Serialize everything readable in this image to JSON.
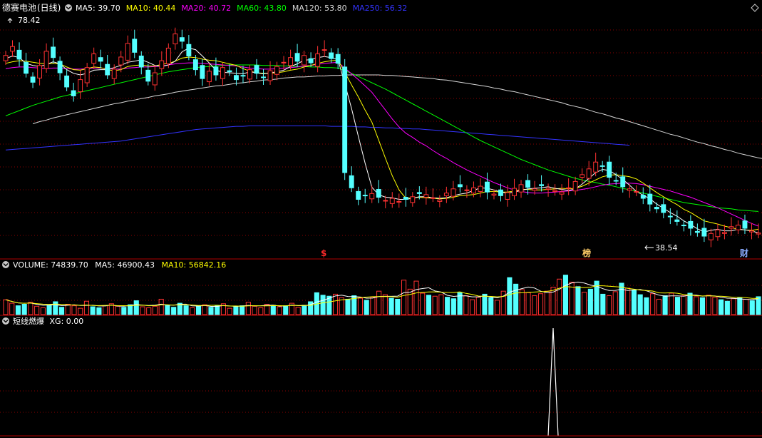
{
  "header": {
    "stock_name": "德赛电池",
    "period": "(日线)",
    "ma": [
      {
        "label": "MA5",
        "value": "39.70",
        "color": "#ffffff"
      },
      {
        "label": "MA10",
        "value": "40.44",
        "color": "#ffff00"
      },
      {
        "label": "MA20",
        "value": "40.72",
        "color": "#ff00ff"
      },
      {
        "label": "MA60",
        "value": "43.80",
        "color": "#00ff00"
      },
      {
        "label": "MA120",
        "value": "53.80",
        "color": "#d8d8d8"
      },
      {
        "label": "MA250",
        "value": "56.32",
        "color": "#3333ff"
      }
    ]
  },
  "price_panel": {
    "max_label": "78.42",
    "min_label": "38.54",
    "markers": [
      {
        "text": "$",
        "color": "#ff2a2a"
      },
      {
        "text": "榜",
        "color": "#ffcc66"
      },
      {
        "text": "财",
        "color": "#88aaff"
      }
    ]
  },
  "volume_header": {
    "title": "VOLUME",
    "value": "74839.70",
    "ma5_label": "MA5",
    "ma5_value": "46900.43",
    "ma10_label": "MA10",
    "ma10_value": "56842.16"
  },
  "indicator_header": {
    "title": "短线燃爆",
    "xg_label": "XG",
    "xg_value": "0.00"
  },
  "colors": {
    "up": "#ff3232",
    "down": "#54ffff",
    "grid": "#8b0000",
    "panel_border": "#b00000"
  },
  "chart_data": {
    "type": "candlestick",
    "series_price": {
      "closes": [
        73.5,
        75.2,
        72.8,
        70.1,
        68.4,
        71.6,
        74.3,
        73.1,
        70.2,
        67.5,
        65.8,
        68.9,
        71.2,
        73.8,
        72.4,
        69.8,
        70.9,
        73.2,
        75.8,
        74.1,
        71.3,
        68.6,
        70.2,
        72.5,
        74.9,
        77.6,
        76.2,
        73.4,
        70.8,
        69.1,
        70.5,
        69.8,
        71.2,
        70.4,
        68.9,
        69.6,
        70.8,
        70.1,
        69.3,
        70.6,
        71.4,
        72.2,
        73.1,
        72.4,
        73.5,
        72.1,
        73.8,
        74.6,
        72.9,
        72.0,
        51.2,
        48.3,
        46.1,
        46.8,
        47.2,
        46.5,
        45.9,
        46.3,
        45.7,
        46.1,
        46.6,
        47.2,
        47.0,
        46.4,
        46.0,
        47.3,
        48.1,
        48.5,
        47.9,
        48.3,
        48.6,
        47.5,
        47.1,
        46.8,
        47.4,
        48.2,
        48.9,
        48.4,
        48.1,
        48.7,
        48.2,
        47.8,
        47.5,
        48.3,
        49.5,
        50.8,
        51.9,
        53.2,
        52.4,
        50.3,
        49.6,
        48.5,
        48.1,
        47.6,
        46.3,
        45.2,
        44.3,
        43.6,
        42.8,
        41.9,
        41.1,
        40.6,
        39.8,
        39.1,
        39.6,
        40.3,
        39.8,
        40.9,
        41.2,
        40.6,
        40.1,
        39.7
      ],
      "ma5": [
        72.9,
        73.4,
        73.1,
        72.0,
        71.6,
        71.4,
        71.8,
        72.3,
        71.9,
        70.8,
        70.1,
        69.8,
        70.1,
        70.7,
        70.8,
        70.8,
        71.2,
        71.6,
        72.2,
        72.4,
        72.7,
        72.2,
        71.6,
        71.4,
        71.7,
        72.4,
        74.2,
        74.9,
        74.6,
        73.4,
        72.1,
        70.7,
        70.3,
        70.2,
        70.1,
        70.0,
        70.4,
        70.2,
        70.0,
        70.2,
        70.4,
        70.7,
        71.4,
        71.9,
        72.6,
        72.7,
        73.1,
        73.3,
        73.1,
        72.7,
        68.1,
        63.4,
        58.1,
        53.0,
        48.4,
        47.0,
        46.5,
        46.4,
        46.1,
        46.1,
        46.3,
        46.6,
        46.6,
        46.4,
        46.3,
        46.4,
        46.8,
        47.1,
        47.3,
        47.8,
        48.3,
        48.2,
        47.9,
        47.5,
        47.3,
        47.5,
        47.8,
        48.1,
        48.2,
        48.3,
        48.5,
        48.2,
        48.0,
        47.8,
        48.1,
        49.0,
        50.1,
        51.2,
        51.8,
        51.6,
        50.8,
        49.9,
        48.8,
        47.6,
        46.9,
        46.2,
        45.2,
        44.4,
        43.6,
        42.9,
        42.0,
        41.3,
        40.5,
        39.9,
        40.2,
        40.4,
        40.1,
        40.1,
        40.4,
        40.3,
        40.1,
        39.7
      ],
      "ma10": [
        72.0,
        72.3,
        72.5,
        72.4,
        72.2,
        72.0,
        71.9,
        72.0,
        71.9,
        71.3,
        70.8,
        70.7,
        71.0,
        71.3,
        71.2,
        70.8,
        70.6,
        70.8,
        71.4,
        71.6,
        71.7,
        71.5,
        71.5,
        71.8,
        72.0,
        72.4,
        73.0,
        73.2,
        73.1,
        72.8,
        72.6,
        72.5,
        72.2,
        71.9,
        71.6,
        71.0,
        70.5,
        70.2,
        70.1,
        70.1,
        70.2,
        70.4,
        70.7,
        70.9,
        71.3,
        71.6,
        72.0,
        72.3,
        72.5,
        72.6,
        70.3,
        67.9,
        65.6,
        63.1,
        60.8,
        57.4,
        53.9,
        50.6,
        47.9,
        46.3,
        46.4,
        46.5,
        46.4,
        46.3,
        46.2,
        46.3,
        46.5,
        46.8,
        46.9,
        47.0,
        47.3,
        47.6,
        47.6,
        47.5,
        47.5,
        47.7,
        48.0,
        48.0,
        47.9,
        47.9,
        48.0,
        48.1,
        48.2,
        48.1,
        48.2,
        48.6,
        49.2,
        49.8,
        50.4,
        50.7,
        50.8,
        50.6,
        50.4,
        50.0,
        49.2,
        48.3,
        47.4,
        46.6,
        45.8,
        45.1,
        44.2,
        43.6,
        42.8,
        42.0,
        41.7,
        41.4,
        41.0,
        40.7,
        40.4,
        40.3,
        40.2,
        40.4
      ],
      "ma20": [
        71.0,
        71.2,
        71.3,
        71.3,
        71.2,
        71.1,
        71.0,
        71.1,
        71.1,
        71.0,
        70.9,
        70.9,
        71.0,
        71.1,
        71.1,
        71.0,
        70.9,
        70.9,
        71.1,
        71.2,
        71.3,
        71.3,
        71.4,
        71.5,
        71.7,
        71.9,
        72.0,
        72.1,
        72.1,
        72.0,
        71.9,
        71.8,
        71.7,
        71.6,
        71.5,
        71.3,
        71.1,
        71.0,
        70.9,
        70.9,
        71.0,
        71.1,
        71.2,
        71.3,
        71.5,
        71.6,
        71.8,
        72.0,
        72.1,
        72.2,
        71.1,
        70.0,
        68.9,
        67.7,
        66.5,
        64.8,
        63.1,
        61.4,
        59.9,
        58.7,
        57.9,
        57.0,
        56.3,
        55.4,
        54.6,
        53.9,
        53.1,
        52.4,
        51.7,
        51.1,
        50.5,
        49.9,
        49.3,
        48.8,
        48.3,
        47.9,
        47.6,
        47.4,
        47.3,
        47.3,
        47.4,
        47.5,
        47.6,
        47.7,
        47.8,
        48.0,
        48.2,
        48.5,
        48.8,
        49.0,
        49.1,
        49.2,
        49.2,
        49.1,
        48.9,
        48.6,
        48.3,
        48.0,
        47.7,
        47.3,
        46.9,
        46.5,
        46.0,
        45.5,
        45.0,
        44.5,
        43.9,
        43.3,
        42.7,
        42.1,
        41.5,
        41.0
      ],
      "ma60": [
        62.0,
        62.5,
        63.0,
        63.5,
        64.0,
        64.4,
        64.8,
        65.2,
        65.6,
        65.9,
        66.2,
        66.5,
        66.8,
        67.1,
        67.4,
        67.7,
        68.0,
        68.3,
        68.6,
        68.9,
        69.2,
        69.5,
        69.8,
        70.1,
        70.4,
        70.6,
        70.8,
        71.0,
        71.2,
        71.3,
        71.4,
        71.5,
        71.6,
        71.7,
        71.7,
        71.7,
        71.7,
        71.7,
        71.6,
        71.6,
        71.6,
        71.5,
        71.5,
        71.4,
        71.4,
        71.3,
        71.3,
        71.2,
        71.2,
        71.1,
        70.6,
        70.1,
        69.5,
        68.9,
        68.3,
        67.7,
        67.1,
        66.4,
        65.7,
        65.0,
        64.3,
        63.6,
        62.9,
        62.2,
        61.5,
        60.8,
        60.1,
        59.4,
        58.7,
        58.0,
        57.3,
        56.7,
        56.1,
        55.5,
        54.9,
        54.3,
        53.7,
        53.2,
        52.7,
        52.2,
        51.7,
        51.3,
        50.9,
        50.5,
        50.1,
        49.8,
        49.5,
        49.3,
        49.0,
        48.8,
        48.5,
        48.2,
        47.9,
        47.6,
        47.3,
        47.0,
        46.7,
        46.4,
        46.1,
        45.8,
        45.5,
        45.3,
        45.1,
        44.9,
        44.7,
        44.5,
        44.4,
        44.3,
        44.1,
        44.0,
        43.9,
        43.8
      ],
      "ma120_start_index": 4,
      "ma120": [
        60.5,
        60.9,
        61.2,
        61.6,
        61.9,
        62.2,
        62.5,
        62.8,
        63.1,
        63.4,
        63.7,
        64.0,
        64.3,
        64.5,
        64.8,
        65.0,
        65.3,
        65.5,
        65.8,
        66.0,
        66.2,
        66.5,
        66.7,
        66.9,
        67.1,
        67.3,
        67.5,
        67.7,
        67.8,
        68.0,
        68.2,
        68.3,
        68.5,
        68.6,
        68.8,
        68.9,
        69.0,
        69.2,
        69.3,
        69.4,
        69.4,
        69.5,
        69.6,
        69.6,
        69.7,
        69.7,
        69.8,
        69.8,
        69.8,
        69.8,
        69.8,
        69.8,
        69.7,
        69.7,
        69.6,
        69.5,
        69.4,
        69.3,
        69.2,
        69.1,
        68.9,
        68.8,
        68.6,
        68.4,
        68.2,
        68.0,
        67.8,
        67.6,
        67.3,
        67.1,
        66.8,
        66.6,
        66.3,
        66.0,
        65.7,
        65.4,
        65.1,
        64.8,
        64.5,
        64.1,
        63.8,
        63.5,
        63.1,
        62.7,
        62.4,
        62.0,
        61.6,
        61.3,
        60.9,
        60.5,
        60.1,
        59.7,
        59.3,
        58.9,
        58.5,
        58.2,
        57.8,
        57.4,
        57.0,
        56.7,
        56.3,
        56.0,
        55.6,
        55.3,
        54.9,
        54.6,
        54.3,
        54.0,
        53.8
      ],
      "ma250_start_index": 0,
      "ma250": [
        55.5,
        55.6,
        55.7,
        55.8,
        55.9,
        56.0,
        56.1,
        56.2,
        56.3,
        56.4,
        56.5,
        56.6,
        56.7,
        56.8,
        56.9,
        57.0,
        57.1,
        57.2,
        57.4,
        57.6,
        57.8,
        58.0,
        58.2,
        58.4,
        58.6,
        58.8,
        59.0,
        59.2,
        59.4,
        59.5,
        59.6,
        59.7,
        59.8,
        59.9,
        60.0,
        60.0,
        60.1,
        60.1,
        60.1,
        60.1,
        60.1,
        60.1,
        60.1,
        60.1,
        60.1,
        60.1,
        60.1,
        60.1,
        60.0,
        60.0,
        60.0,
        60.0,
        59.9,
        59.9,
        59.8,
        59.8,
        59.7,
        59.7,
        59.6,
        59.6,
        59.5,
        59.5,
        59.4,
        59.3,
        59.2,
        59.1,
        59.0,
        58.9,
        58.8,
        58.7,
        58.6,
        58.5,
        58.4,
        58.3,
        58.2,
        58.1,
        58.0,
        57.9,
        57.8,
        57.7,
        57.6,
        57.5,
        57.4,
        57.3,
        57.2,
        57.1,
        57.0,
        56.9,
        56.8,
        56.7,
        56.6,
        56.5,
        56.4
      ],
      "y_range": [
        37.2,
        80.8
      ]
    },
    "series_volume": {
      "values": [
        3.1,
        2.4,
        1.9,
        2.2,
        2.6,
        1.8,
        1.5,
        2.0,
        2.7,
        1.6,
        2.2,
        1.9,
        1.4,
        2.8,
        1.7,
        1.5,
        1.9,
        2.3,
        1.8,
        1.6,
        2.1,
        2.9,
        1.7,
        1.5,
        1.8,
        3.2,
        2.0,
        1.6,
        2.4,
        1.9,
        1.5,
        1.8,
        2.1,
        1.6,
        1.9,
        2.3,
        1.4,
        1.7,
        1.9,
        2.6,
        1.8,
        1.5,
        2.2,
        2.0,
        1.7,
        1.9,
        2.4,
        1.6,
        2.0,
        2.7,
        4.5,
        4.0,
        3.8,
        4.2,
        3.5,
        3.2,
        3.9,
        3.4,
        3.0,
        3.6,
        4.8,
        4.1,
        3.4,
        3.2,
        7.0,
        5.2,
        6.8,
        4.4,
        4.0,
        3.8,
        4.1,
        3.6,
        3.3,
        4.5,
        3.9,
        3.1,
        3.6,
        4.2,
        3.5,
        3.0,
        4.8,
        7.5,
        6.2,
        5.1,
        4.5,
        3.9,
        4.3,
        4.8,
        5.6,
        7.2,
        8.0,
        6.6,
        5.7,
        4.6,
        5.2,
        6.8,
        4.2,
        3.9,
        4.7,
        6.4,
        5.4,
        5.0,
        4.1,
        3.5,
        4.3,
        3.2,
        3.9,
        4.4,
        3.6,
        3.9,
        4.4,
        3.7,
        3.5,
        4.0,
        3.6,
        3.1,
        2.8,
        3.3,
        3.5,
        3.2,
        2.9,
        3.7
      ],
      "up_flags": [
        1,
        1,
        0,
        0,
        1,
        1,
        1,
        0,
        0,
        0,
        1,
        1,
        1,
        1,
        0,
        0,
        1,
        1,
        1,
        0,
        0,
        0,
        1,
        1,
        1,
        1,
        0,
        0,
        0,
        0,
        1,
        0,
        1,
        0,
        0,
        1,
        1,
        0,
        0,
        1,
        1,
        1,
        1,
        0,
        1,
        0,
        1,
        1,
        0,
        0,
        0,
        0,
        0,
        1,
        1,
        0,
        0,
        1,
        0,
        1,
        1,
        1,
        0,
        0,
        1,
        1,
        1,
        1,
        0,
        1,
        1,
        0,
        0,
        0,
        1,
        1,
        1,
        0,
        0,
        1,
        1,
        0,
        0,
        1,
        1,
        1,
        1,
        1,
        1,
        1,
        0,
        1,
        0,
        1,
        0,
        0,
        0,
        1,
        1,
        0,
        1,
        0,
        0,
        0,
        1,
        1,
        0,
        1,
        0,
        1,
        0,
        1,
        0,
        1,
        1,
        0,
        0,
        1,
        0,
        1,
        0,
        0
      ],
      "y_max": 8.8
    },
    "series_indicator": {
      "xg_values_count": 122,
      "spike_index": 88,
      "spike_value": 1.0
    }
  }
}
